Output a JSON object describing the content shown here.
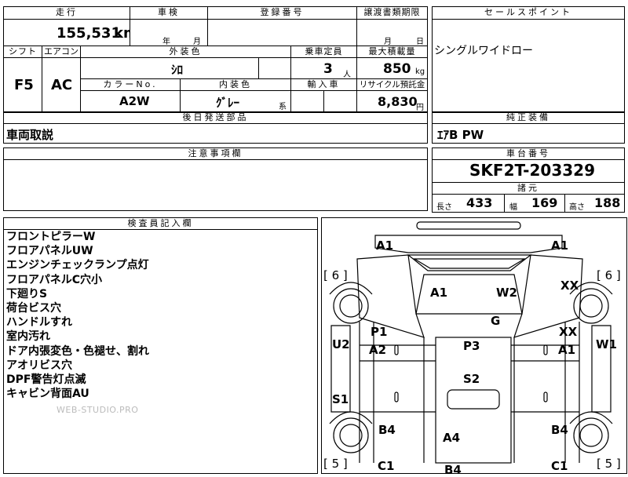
{
  "headers": {
    "mileage": "走行",
    "inspection": "車検",
    "registration": "登録番号",
    "transfer_deadline": "譲渡書類期限",
    "sales_point": "セールスポイント",
    "shift": "シフト",
    "aircon": "エアコン",
    "exterior_color": "外装色",
    "capacity": "乗車定員",
    "max_load": "最大積載量",
    "color_no": "カラーNo.",
    "interior_color": "内装色",
    "import": "輸入車",
    "recycle": "リサイクル預託金",
    "later_parts": "後日発送部品",
    "factory_equipment": "純正装備",
    "notes": "注意事項欄",
    "chassis_no": "車台番号",
    "specs": "諸元",
    "inspector": "検査員記入欄"
  },
  "values": {
    "mileage": "155,531",
    "mileage_unit": "km",
    "year_label": "年",
    "month_label": "月",
    "transfer_month_label": "月",
    "transfer_day_label": "日",
    "shift": "F5",
    "aircon": "AC",
    "exterior_color": "ｼﾛ",
    "capacity": "3",
    "capacity_unit": "人",
    "max_load": "850",
    "max_load_unit": "kg",
    "color_no": "A2W",
    "interior_color": "ｸﾞﾚｰ",
    "interior_suffix": "系",
    "recycle": "8,830",
    "recycle_unit": "円",
    "sales_point": "シングルワイドロー",
    "later_parts": "車両取説",
    "factory_equipment": "ｴｱB PW",
    "chassis_no": "SKF2T-203329",
    "length_label": "長さ",
    "length": "433",
    "width_label": "幅",
    "width": "169",
    "height_label": "高さ",
    "height": "188"
  },
  "inspector_notes": [
    "フロントピラーW",
    "フロアパネルUW",
    "エンジンチェックランプ点灯",
    "フロアパネルC穴小",
    "下廻りS",
    "荷台ビス穴",
    "ハンドルすれ",
    "室内汚れ",
    "ドア内張変色・色褪せ、割れ",
    "アオリビス穴",
    "DPF警告灯点滅",
    "キャビン背面AU"
  ],
  "watermark": "WEB-STUDIO.PRO",
  "diagram": {
    "tl": "A1",
    "tr": "A1",
    "bracket_tl": "[ 6 ]",
    "bracket_tr": "[ 6 ]",
    "bracket_bl": "[ 5 ]",
    "bracket_br": "[ 5 ]",
    "a1": "A1",
    "w2": "W2",
    "xx_top": "XX",
    "g": "G",
    "p1": "P1",
    "a2": "A2",
    "u2": "U2",
    "p3": "P3",
    "xx_mid": "XX",
    "a1_right": "A1",
    "w1": "W1",
    "s1": "S1",
    "s2": "S2",
    "b4_left": "B4",
    "b4_right": "B4",
    "a4": "A4",
    "c1_left": "C1",
    "c1_right": "C1",
    "b4_bottom": "B4"
  }
}
